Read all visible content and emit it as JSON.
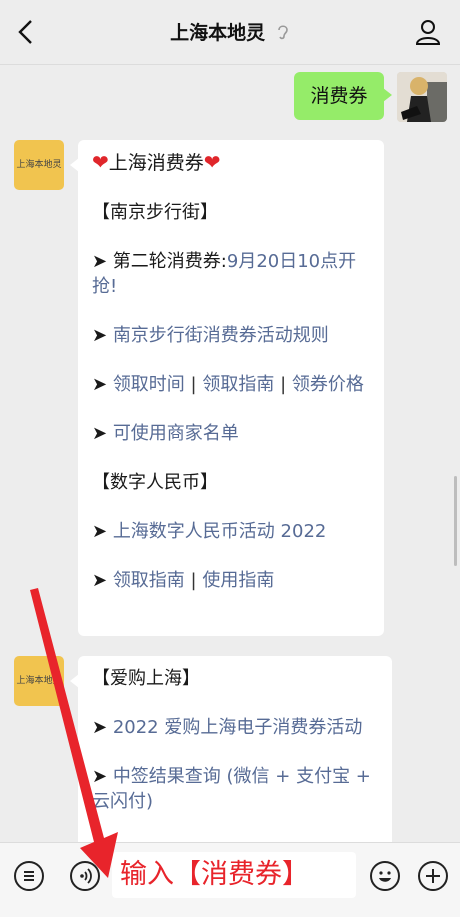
{
  "header": {
    "title": "上海本地灵"
  },
  "sent": {
    "text": "消费券"
  },
  "msg1": {
    "avatar_label": "上海本地灵",
    "title": "上海消费券",
    "section1": "【南京步行街】",
    "round_prefix": "➤ 第二轮消费券:",
    "round_link": "9月20日10点开抢!",
    "rules_link": "南京步行街消费券活动规则",
    "claim_time": "领取时间",
    "claim_guide": "领取指南",
    "coupon_price": "领券价格",
    "merchants": "可使用商家名单",
    "section2": "【数字人民币】",
    "digital_event": "上海数字人民币活动 2022",
    "claim_guide2": "领取指南",
    "use_guide": "使用指南"
  },
  "msg2": {
    "avatar_label": "上海本地灵",
    "section": "【爱购上海】",
    "event_link": "2022 爱购上海电子消费券活动",
    "result_text": "中签结果查询 (微信 + 支付宝 + 云闪付)"
  },
  "bottom": {
    "input_text": "输入【消费券】"
  },
  "colors": {
    "accent_green": "#95ec69",
    "link": "#576b95",
    "annotation_red": "#e8242b"
  }
}
